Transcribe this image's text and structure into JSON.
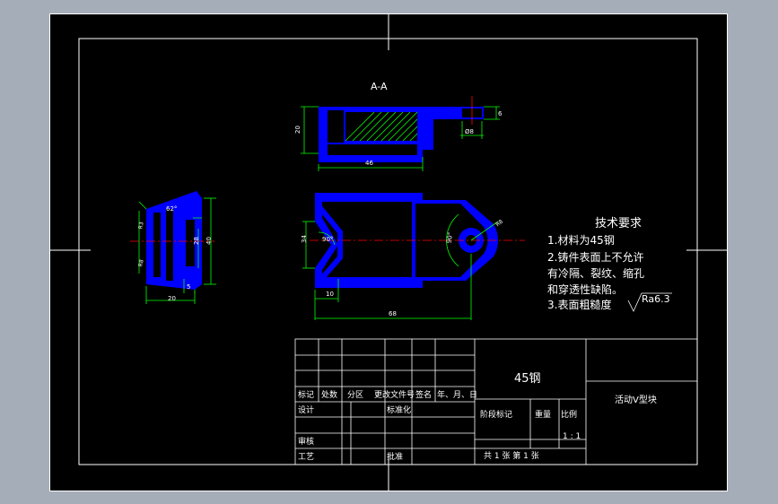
{
  "section_label": "A-A",
  "dimensions": {
    "top_height": "20",
    "top_length": "46",
    "top_hole": "Ø8",
    "top_small": "6",
    "left_angle": "62°",
    "left_h1": "28",
    "left_h2": "40",
    "left_w1": "20",
    "left_w2": "5",
    "left_r1": "R3",
    "left_r2": "R8",
    "front_h": "34",
    "front_ang1": "90°",
    "front_ang2": "90°",
    "front_r": "R8",
    "front_w1": "10",
    "front_w2": "68"
  },
  "tech_requirements": {
    "title": "技术要求",
    "items": [
      "1.材料为45钢",
      "2.铸件表面上不允许",
      "有冷隔、裂纹、缩孔",
      "和穿透性缺陷。",
      "3.表面粗糙度"
    ],
    "roughness": "Ra6.3"
  },
  "title_block": {
    "material": "45钢",
    "part_name": "活动V型块",
    "labels": {
      "mark": "标记",
      "count": "处数",
      "zone": "分区",
      "change_doc": "更改文件号",
      "sign": "签名",
      "date": "年、月、日",
      "design": "设计",
      "standard": "标准化",
      "review": "审核",
      "process": "工艺",
      "approve": "批准",
      "stage_mark": "阶段标记",
      "weight": "重量",
      "scale": "比例"
    },
    "scale_value": "1 : 1",
    "sheets": "共 1 张  第 1 张"
  },
  "colors": {
    "background": "#000000",
    "part": "#0000ff",
    "dimension": "#00ff00",
    "centerline": "#ff0000",
    "text": "#ffffff"
  }
}
